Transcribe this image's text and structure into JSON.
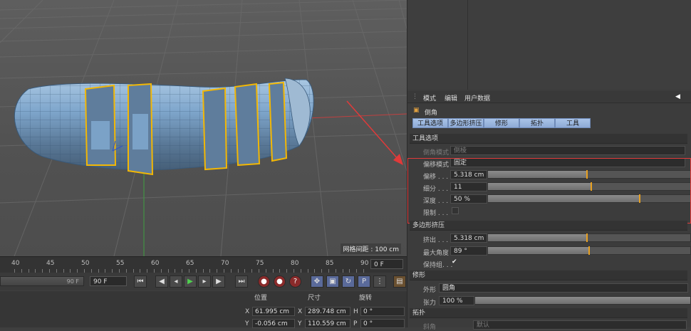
{
  "viewport": {
    "grid_distance": "网格间距 : 100 cm"
  },
  "timeline": {
    "ticks": [
      "40",
      "45",
      "50",
      "55",
      "60",
      "65",
      "70",
      "75",
      "80",
      "85",
      "90"
    ],
    "current_frame": "0 F"
  },
  "transport": {
    "start_value": "90 F",
    "end_value": "90 F"
  },
  "coordinates": {
    "headers": {
      "position": "位置",
      "size": "尺寸",
      "rotation": "旋转"
    },
    "rows": [
      {
        "axis": "X",
        "position": "61.995 cm",
        "size_axis": "X",
        "size": "289.748 cm",
        "rot_axis": "H",
        "rotation": "0 °"
      },
      {
        "axis": "Y",
        "position": "-0.056 cm",
        "size_axis": "Y",
        "size": "110.559 cm",
        "rot_axis": "P",
        "rotation": "0 °"
      }
    ]
  },
  "attributes": {
    "menu": [
      "模式",
      "编辑",
      "用户数据"
    ],
    "title": "倒角",
    "tabs": [
      "工具选项",
      "多边形挤压",
      "修形",
      "拓扑",
      "工具"
    ],
    "tool_options": {
      "section": "工具选项",
      "bevel_mode_label": "倒角模式",
      "bevel_mode_value": "倒棱",
      "offset_mode_label": "偏移模式",
      "offset_mode_value": "固定",
      "offset_label": "偏移 . . .",
      "offset_value": "5.318 cm",
      "offset_fraction": 0.49,
      "subdivision_label": "细分 . . .",
      "subdivision_value": "11",
      "subdivision_fraction": 0.51,
      "depth_label": "深度 . . .",
      "depth_value": "50 %",
      "depth_fraction": 0.75,
      "limit_label": "限制 . . ."
    },
    "extrude": {
      "section": "多边形挤压",
      "extrude_label": "挤出 . . .",
      "extrude_value": "5.318 cm",
      "extrude_fraction": 0.49,
      "max_angle_label": "最大角度",
      "max_angle_value": "89 °",
      "max_angle_fraction": 0.5,
      "keep_group_label": "保持组. . .",
      "keep_group_checked": true
    },
    "shaping": {
      "section": "修形",
      "shape_label": "外形",
      "shape_value": "圆角",
      "tension_label": "张力",
      "tension_value": "100 %"
    },
    "topology": {
      "section": "拓扑",
      "row_label": "斜角",
      "row_value": "默认"
    }
  },
  "colors": {
    "accent_yellow": "#f2b705",
    "mesh_blue": "#6aa7d8",
    "annotation_red": "#e03a3a",
    "tab_blue": "#9bb6e0"
  }
}
